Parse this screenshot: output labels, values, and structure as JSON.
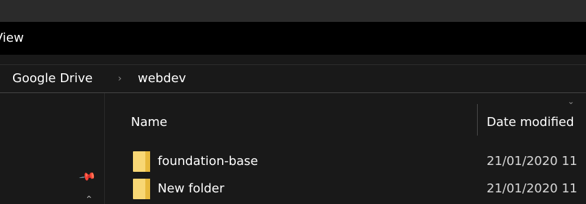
{
  "menu": {
    "view_label": "View"
  },
  "address": {
    "crumbs": [
      "Google Drive",
      "webdev"
    ],
    "separator": "›"
  },
  "columns": {
    "name": "Name",
    "date_modified": "Date modified"
  },
  "files": [
    {
      "name": "foundation-base",
      "date": "21/01/2020 11",
      "icon": "folder-icon"
    },
    {
      "name": "New folder",
      "date": "21/01/2020 11",
      "icon": "folder-icon"
    }
  ],
  "icons": {
    "pin": "pin-icon",
    "sort": "chevron-down-icon"
  },
  "colors": {
    "background": "#191919",
    "menu_bar": "#000000",
    "folder": "#f8d775",
    "folder_tab": "#e8b93d"
  }
}
